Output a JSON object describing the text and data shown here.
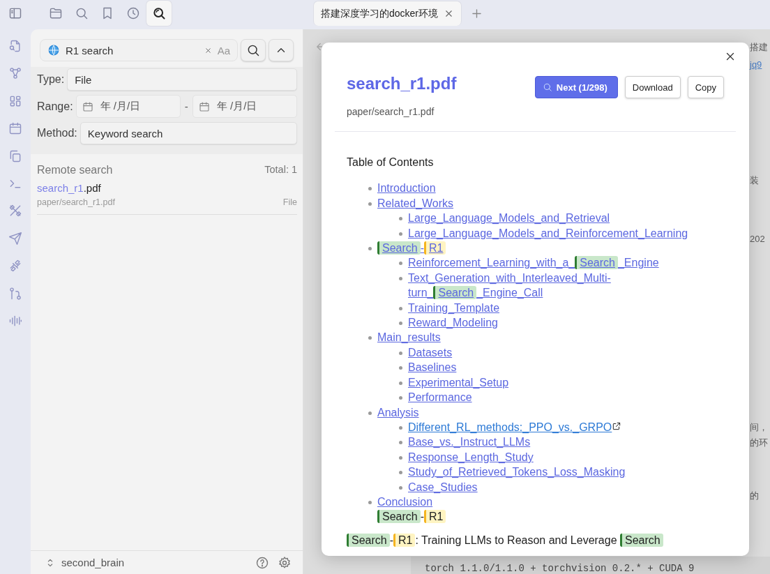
{
  "nav_tabs": [
    {
      "selected": false
    },
    {
      "selected": false
    },
    {
      "selected": false
    },
    {
      "selected": false
    },
    {
      "selected": true
    }
  ],
  "editor_tabs": [
    {
      "title": "搭建深度学习的docker环境",
      "selected": true
    }
  ],
  "search": {
    "value": "R1 search",
    "case_toggle": "Aa"
  },
  "filters": [
    {
      "label": "Type:",
      "kind": "select",
      "value": "File"
    },
    {
      "label": "Range:",
      "kind": "daterange",
      "from": "年 /月/日",
      "separator": "-",
      "to": "年 /月/日"
    },
    {
      "label": "Method:",
      "kind": "select",
      "value": "Keyword search"
    }
  ],
  "results": {
    "heading": "Remote search",
    "total": "Total: 1",
    "items": [
      {
        "name": [
          {
            "text": "search_r1",
            "match": true
          },
          {
            "text": ".pdf",
            "match": false
          }
        ],
        "path": "paper/search_r1.pdf",
        "type": "File"
      }
    ]
  },
  "vault": {
    "name": "second_brain"
  },
  "backdrop": {
    "fragments": [
      {
        "text": "搭建",
        "kind": "text"
      },
      {
        "text": "jq9",
        "kind": "link"
      },
      {
        "text": "装",
        "kind": "text"
      },
      {
        "text": "202",
        "kind": "text"
      },
      {
        "text": "间，",
        "kind": "text"
      },
      {
        "text": "的环",
        "kind": "text"
      },
      {
        "text": "的",
        "kind": "text"
      }
    ],
    "code": "torch 1.1.0/1.1.0 + torchvision 0.2.* + CUDA 9"
  },
  "modal": {
    "title": "search_r1.pdf",
    "path": "paper/search_r1.pdf",
    "buttons": [
      {
        "label": "Next (1/298)",
        "kind": "primary"
      },
      {
        "label": "Download",
        "kind": "default"
      },
      {
        "label": "Copy",
        "kind": "default"
      }
    ],
    "toc": {
      "heading": "Table of Contents",
      "items": [
        {
          "title": "Introduction"
        },
        {
          "title": "Related_Works",
          "children": [
            {
              "title": "Large_Language_Models_and_Retrieval"
            },
            {
              "title": "Large_Language_Models_and_Reinforcement_Learning"
            }
          ]
        },
        {
          "parts": [
            {
              "text": "Search",
              "kind": "term1"
            },
            {
              "text": "-",
              "kind": "plain"
            },
            {
              "text": "R1",
              "kind": "term2"
            }
          ],
          "children": [
            {
              "parts": [
                {
                  "text": "Reinforcement_Learning_with_a_",
                  "kind": "plain"
                },
                {
                  "text": "Search",
                  "kind": "term1"
                },
                {
                  "text": "_Engine",
                  "kind": "plain"
                }
              ]
            },
            {
              "parts": [
                {
                  "text": "Text_Generation_with_Interleaved_Multi-turn_",
                  "kind": "plain"
                },
                {
                  "text": "Search",
                  "kind": "term1"
                },
                {
                  "text": "_Engine_Call",
                  "kind": "plain"
                }
              ]
            },
            {
              "title": "Training_Template"
            },
            {
              "title": "Reward_Modeling"
            }
          ]
        },
        {
          "title": "Main_results",
          "children": [
            {
              "title": "Datasets"
            },
            {
              "title": "Baselines"
            },
            {
              "title": "Experimental_Setup"
            },
            {
              "title": "Performance"
            }
          ]
        },
        {
          "title": "Analysis",
          "children": [
            {
              "title": "Different_RL_methods:_PPO_vs._GRPO",
              "external": true
            },
            {
              "title": "Base_vs._Instruct_LLMs"
            },
            {
              "title": "Response_Length_Study"
            },
            {
              "title": "Study_of_Retrieved_Tokens_Loss_Masking"
            },
            {
              "title": "Case_Studies"
            }
          ]
        },
        {
          "title": "Conclusion"
        }
      ]
    },
    "subtitle": [
      {
        "text": "Search",
        "kind": "term1"
      },
      {
        "text": "-",
        "kind": "plain"
      },
      {
        "text": "R1",
        "kind": "term2"
      }
    ],
    "heading": [
      {
        "text": "Search",
        "kind": "term1"
      },
      {
        "text": "-",
        "kind": "plain"
      },
      {
        "text": "R1",
        "kind": "term2"
      },
      {
        "text": ": Training LLMs to Reason and Leverage ",
        "kind": "plain"
      },
      {
        "text": "Search",
        "kind": "term1"
      }
    ]
  }
}
